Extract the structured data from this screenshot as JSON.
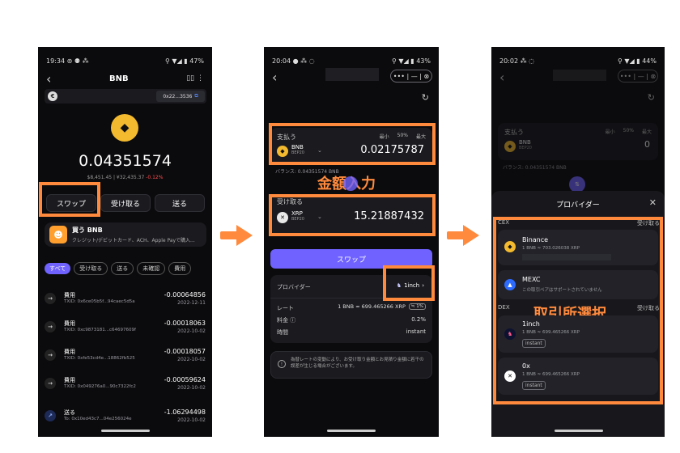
{
  "phone1": {
    "status": {
      "time": "19:34",
      "icons_left": "⊚ ⚉ ⁂",
      "icons_right": "⚲ ▼◢ ▮ 47%"
    },
    "header": {
      "title": "BNB",
      "back_icon": "‹",
      "right_icons": "▯▯  ⋮"
    },
    "address": {
      "value": "0x22...3536"
    },
    "balance": {
      "value": "0.04351574",
      "fiat": "$8,451.45 | ¥32,435.37",
      "change": "-0.12%"
    },
    "actions": {
      "swap": "スワップ",
      "receive": "受け取る",
      "send": "送る"
    },
    "buy": {
      "title": "買う BNB",
      "subtitle": "クレジット/デビットカード、ACH、Apple Payで購入..."
    },
    "filters": [
      "すべて",
      "受け取る",
      "送る",
      "未確認",
      "費用"
    ],
    "tx": [
      {
        "type": "費用",
        "txid": "TXID: 0x6ce05b5f...94caec5d5a",
        "amount": "-0.00064856",
        "date": "2022-12-11"
      },
      {
        "type": "費用",
        "txid": "TXID: 0xc9873181...c64697609f",
        "amount": "-0.00018063",
        "date": "2022-10-02"
      },
      {
        "type": "費用",
        "txid": "TXID: 0xfe53cd4e...18862fb525",
        "amount": "-0.00018057",
        "date": "2022-10-02"
      },
      {
        "type": "費用",
        "txid": "TXID: 0x049276a0...90c7322fc2",
        "amount": "-0.00059624",
        "date": "2022-10-02"
      },
      {
        "type": "送る",
        "txid": "To: 0x10ed43c7...04e256024e",
        "amount": "-1.06294498",
        "date": "2022-10-02"
      }
    ]
  },
  "phone2": {
    "status": {
      "time": "20:04",
      "icons_left": "● ⁂ ◌",
      "icons_right": "⚲ ▼◢ ▮ 43%"
    },
    "pay": {
      "label": "支払う",
      "min": "最小",
      "half": "50%",
      "max": "最大",
      "coin": "BNB",
      "chain": "BEP20",
      "amount": "0.02175787",
      "balance": "バランス: 0.04351574 BNB"
    },
    "receive": {
      "label": "受け取る",
      "coin": "XRP",
      "chain": "BEP20",
      "amount": "15.21887432"
    },
    "annotation": "金額入力",
    "swap_button": "スワップ",
    "provider": {
      "label": "プロバイダー",
      "value": "1inch"
    },
    "rate": {
      "label": "レート",
      "value": "1 BNB ≈ 699.465266 XRP",
      "pct": "≒ 1%"
    },
    "fee": {
      "label": "料金 ⓘ",
      "value": "0.2%"
    },
    "time": {
      "label": "時間",
      "value": "instant"
    },
    "notice": "為替レートの変動により、お受け取り金額とお見積り金額に若干の誤差が生じる場合がございます。"
  },
  "phone3": {
    "status": {
      "time": "20:02",
      "icons_left": "⁂ ◌",
      "icons_right": "⚲ ▼◢ ▮ 44%"
    },
    "pay": {
      "label": "支払う",
      "min": "最小",
      "half": "50%",
      "max": "最大",
      "coin": "BNB",
      "chain": "BEP20",
      "amount": "0",
      "balance": "バランス: 0.04351574 BNB"
    },
    "sheet": {
      "title": "プロバイダー",
      "close": "✕"
    },
    "cex": {
      "label": "CEX",
      "receive_label": "受け取る"
    },
    "dex": {
      "label": "DEX",
      "receive_label": "受け取る"
    },
    "annotation": "取引所選択",
    "providers": [
      {
        "name": "Binance",
        "rate": "1 BNB ≈ 703.026038 XRP"
      },
      {
        "name": "MEXC",
        "rate": "この取引ペアはサポートされていません"
      },
      {
        "name": "1inch",
        "rate": "1 BNB ≈ 699.465266 XRP",
        "badge": "instant"
      },
      {
        "name": "0x",
        "rate": "1 BNB ≈ 699.465266 XRP",
        "badge": "instant"
      }
    ]
  },
  "colors": {
    "accent": "#ff8a3d",
    "swap_button": "#6f62ff",
    "negative": "#ff4d4f"
  }
}
